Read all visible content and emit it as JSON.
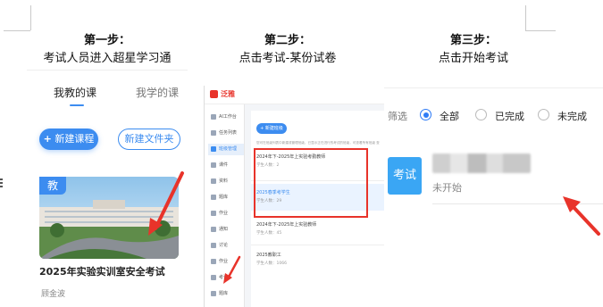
{
  "steps": [
    {
      "title": "第一步：",
      "desc": "考试人员进入超星学习通"
    },
    {
      "title": "第二步：",
      "desc": "点击考试-某份试卷"
    },
    {
      "title": "第三步：",
      "desc": "点击开始考试"
    }
  ],
  "panel1": {
    "tab_taught": "我教的课",
    "tab_learned": "我学的课",
    "new_course": "新建课程",
    "new_folder": "新建文件夹",
    "badge": "教",
    "course_title": "2025年实验实训室安全考试",
    "teacher": "顾金波"
  },
  "panel2": {
    "logo_text": "泛雅",
    "sidebar": [
      "AI工作台",
      "任务列表",
      "班级管理",
      "课件",
      "资料",
      "题库",
      "作业",
      "通知",
      "讨论",
      "作业",
      "考试",
      "题库"
    ],
    "new_button": "+ 新建班级",
    "hint": "您可在班级列表中新建或管理班级，已显示正在进行的考试的班级，可查看所有班级 查看已结束",
    "classes": [
      {
        "name": "2024年下-2025年上实验考勤教师",
        "count": "学生人数：2"
      },
      {
        "name": "2025春季考学生",
        "count": "学生人数：29"
      },
      {
        "name": "2024年下-2025年上实验教师",
        "count": "学生人数：45"
      },
      {
        "name": "2025教职工",
        "count": "学生人数：1066"
      }
    ]
  },
  "panel3": {
    "filter_label": "筛选",
    "options": [
      "全部",
      "已完成",
      "未完成"
    ],
    "exam_tile": "考试",
    "status": "未开始"
  },
  "colors": {
    "accent": "#3c8cf0",
    "arrow": "#e8332a",
    "highlight": "#e8332a"
  }
}
